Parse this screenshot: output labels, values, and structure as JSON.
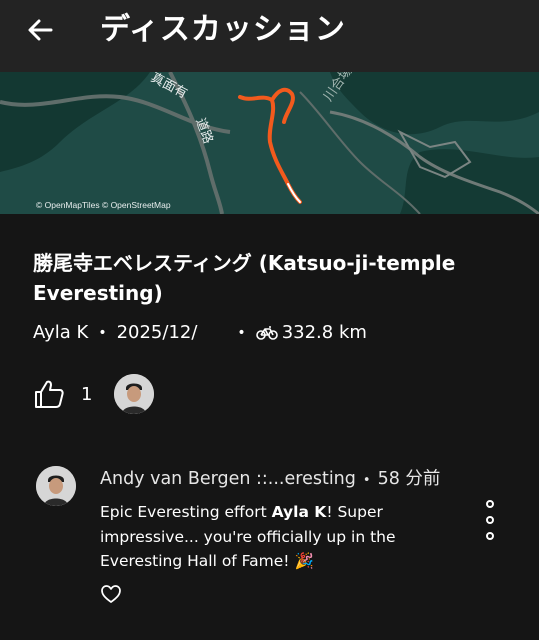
{
  "header": {
    "title": "ディスカッション",
    "back_icon": "back-arrow-icon"
  },
  "map": {
    "attribution": "© OpenMapTiles © OpenStreetMap",
    "labels": {
      "road_1": "真面有",
      "road_2": "道路",
      "river": "川合場川"
    },
    "colors": {
      "land": "#1f4b46",
      "dark_land": "#133832",
      "route": "#f25a1d"
    }
  },
  "activity": {
    "title": "勝尾寺エベレスティング (Katsuo-ji-temple Everesting)",
    "athlete": "Ayla K",
    "date": "2025/12/",
    "distance": "332.8 km",
    "sport_icon": "bike-icon"
  },
  "kudos": {
    "count": "1",
    "icon": "thumbs-up-icon"
  },
  "comment": {
    "author": "Andy van Bergen ::...eresting",
    "time": "58 分前",
    "text_before": "Epic Everesting effort ",
    "mention": "Ayla K",
    "text_after": "! Super impressive... you're officially up in the Everesting Hall of Fame! 🎉"
  },
  "separator": "•"
}
